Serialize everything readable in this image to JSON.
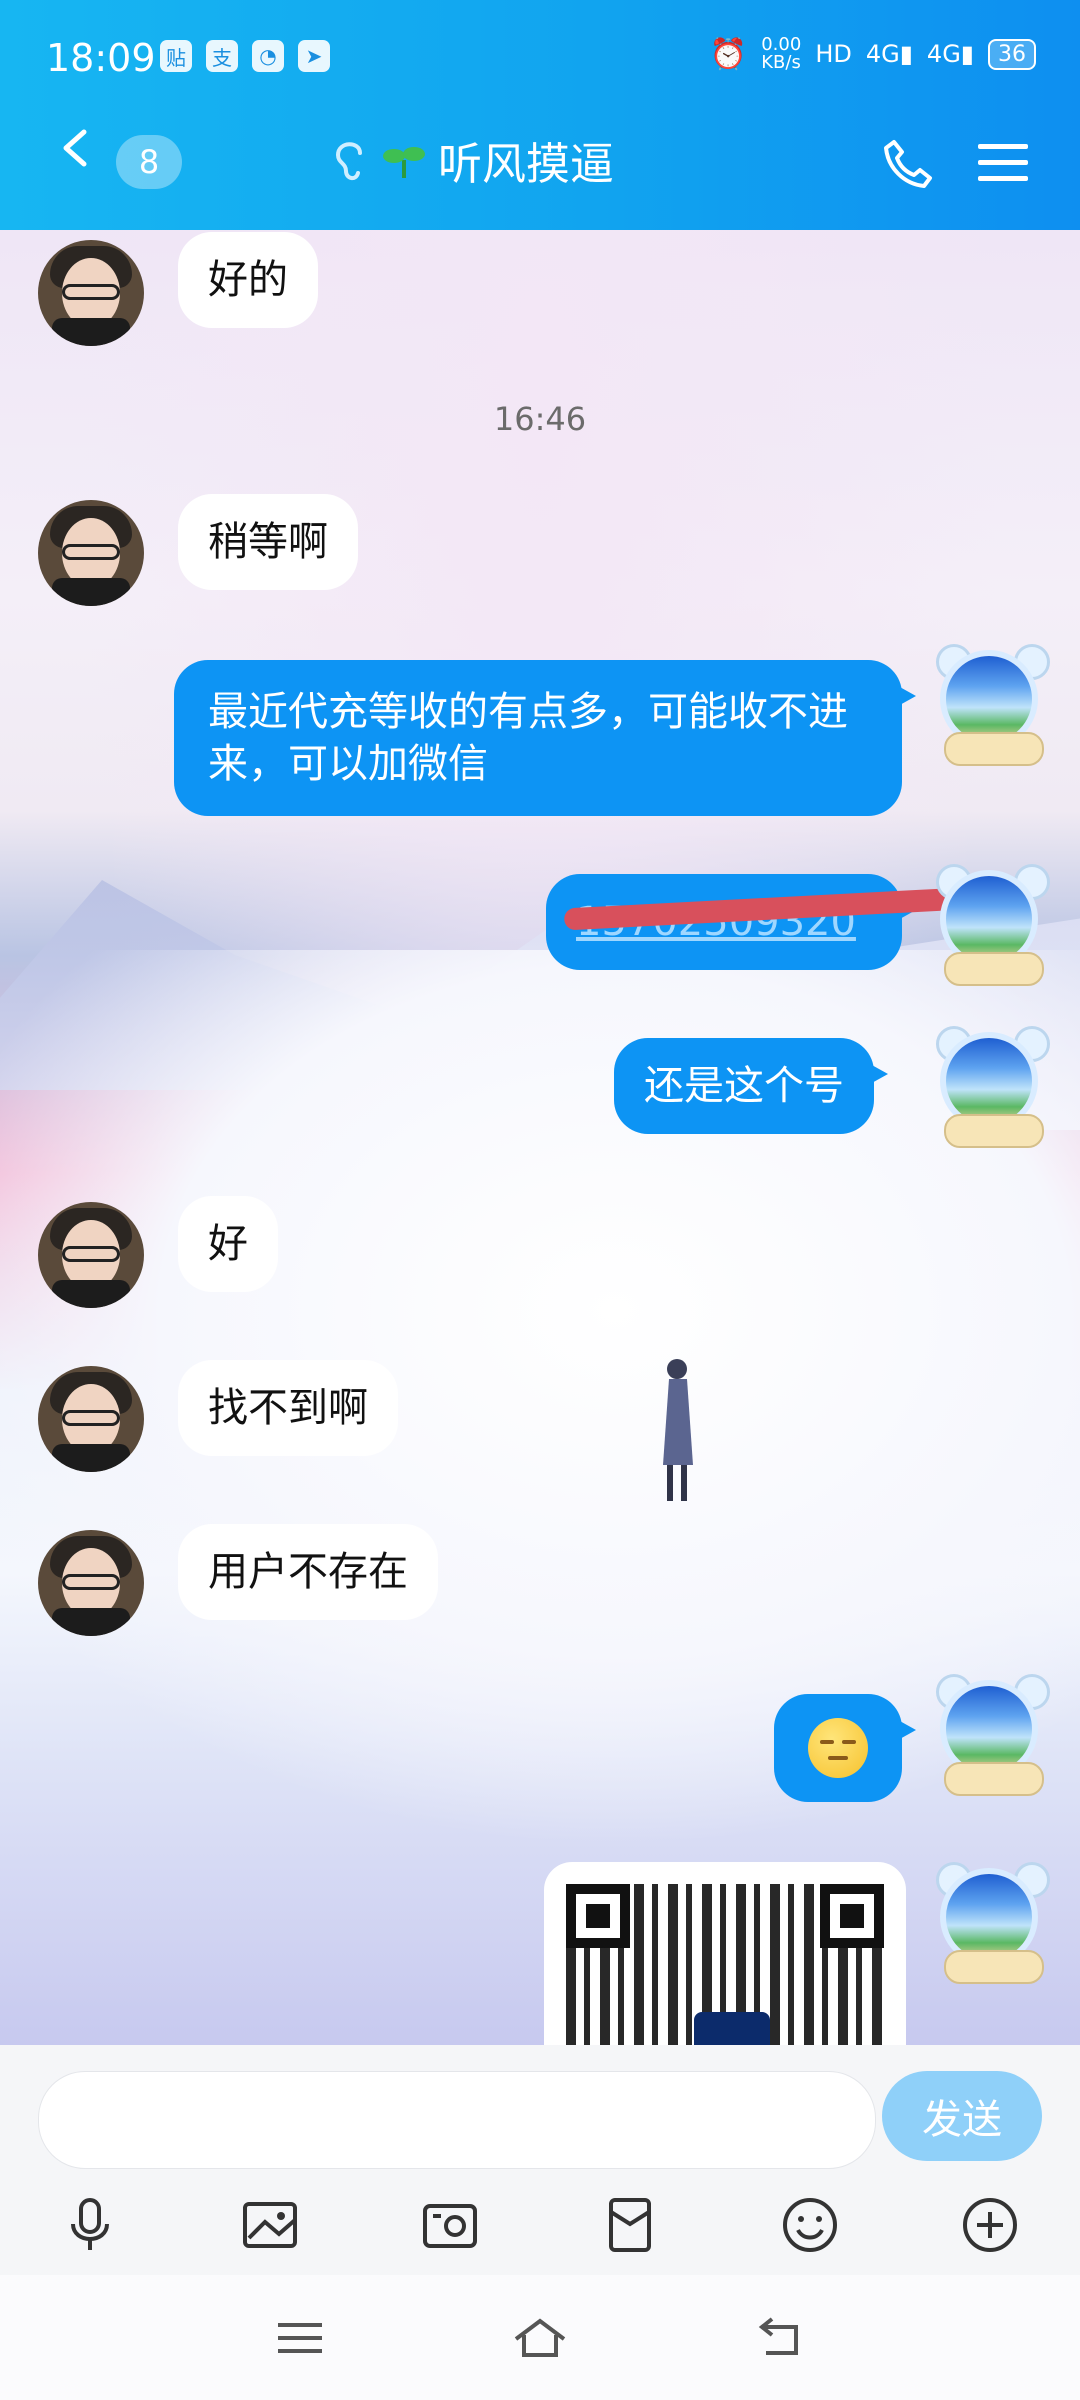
{
  "status_bar": {
    "time": "18:09",
    "net_speed": "0.00\nKB/s",
    "battery": "36",
    "app_icons": [
      "sticker-icon",
      "alipay-icon",
      "compass-icon",
      "send-icon"
    ]
  },
  "header": {
    "unread_count": "8",
    "contact_name": "听风摸逼",
    "contact_prefix_icon": "sprout-icon"
  },
  "chat": {
    "timestamp": "16:46",
    "messages": [
      {
        "side": "in",
        "text": "好的"
      },
      {
        "side": "in",
        "text": "稍等啊"
      },
      {
        "side": "out",
        "text": "最近代充等收的有点多，可能收不进来，可以加微信"
      },
      {
        "side": "out",
        "text": "15702509320",
        "redacted": true
      },
      {
        "side": "out",
        "text": "还是这个号"
      },
      {
        "side": "in",
        "text": "好"
      },
      {
        "side": "in",
        "text": "找不到啊"
      },
      {
        "side": "in",
        "text": "用户不存在"
      },
      {
        "side": "out",
        "emoji": "smirk-emoji"
      },
      {
        "side": "out",
        "image": "qr-code"
      }
    ]
  },
  "input_bar": {
    "placeholder": "",
    "send_label": "发送",
    "tools": [
      "microphone-icon",
      "image-icon",
      "camera-icon",
      "red-packet-icon",
      "emoji-icon",
      "plus-icon"
    ]
  },
  "colors": {
    "header": "#13a6f0",
    "out_bubble": "#0d94f4",
    "in_bubble": "#ffffff",
    "send_button": "#8fd0f9",
    "redaction": "#d8505c"
  }
}
